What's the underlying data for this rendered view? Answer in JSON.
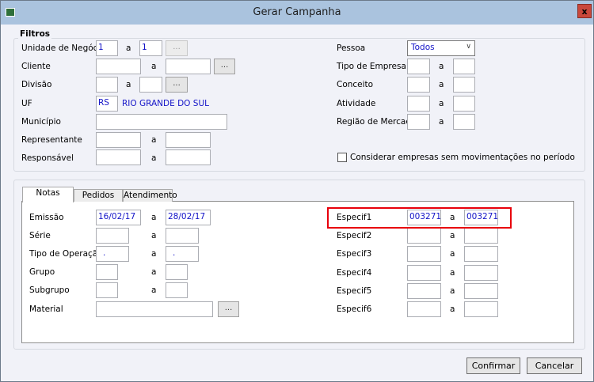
{
  "window": {
    "title": "Gerar Campanha",
    "close_label": "x"
  },
  "filtros": {
    "title": "Filtros",
    "unidade": {
      "label": "Unidade de Negócio",
      "from": "1",
      "sep": "a",
      "to": "1",
      "btn": "..."
    },
    "cliente": {
      "label": "Cliente",
      "from": "",
      "sep": "a",
      "to": "",
      "btn": "..."
    },
    "divisao": {
      "label": "Divisão",
      "from": "",
      "sep": "a",
      "to": "",
      "btn": "..."
    },
    "uf": {
      "label": "UF",
      "code": "RS",
      "name": "RIO GRANDE DO SUL"
    },
    "municipio": {
      "label": "Município",
      "value": ""
    },
    "representante": {
      "label": "Representante",
      "from": "",
      "sep": "a",
      "to": ""
    },
    "responsavel": {
      "label": "Responsável",
      "from": "",
      "sep": "a",
      "to": ""
    },
    "pessoa": {
      "label": "Pessoa",
      "value": "Todos"
    },
    "tipo_empresa": {
      "label": "Tipo de Empresa",
      "sep": "a"
    },
    "conceito": {
      "label": "Conceito",
      "sep": "a"
    },
    "atividade": {
      "label": "Atividade",
      "sep": "a"
    },
    "regiao": {
      "label": "Região de Mercado",
      "sep": "a"
    },
    "considerar": {
      "label": "Considerar empresas sem movimentações no período",
      "checked": false
    }
  },
  "tabs": [
    {
      "label": "Notas",
      "active": true
    },
    {
      "label": "Pedidos"
    },
    {
      "label": "Atendimento"
    }
  ],
  "notas": {
    "emissao": {
      "label": "Emissão",
      "from": "16/02/17",
      "sep": "a",
      "to": "28/02/17"
    },
    "serie": {
      "label": "Série",
      "from": "",
      "sep": "a",
      "to": ""
    },
    "tipo_operacao": {
      "label": "Tipo de Operação",
      "from": ".",
      "sep": "a",
      "to": "."
    },
    "grupo": {
      "label": "Grupo",
      "from": "",
      "sep": "a",
      "to": ""
    },
    "subgrupo": {
      "label": "Subgrupo",
      "from": "",
      "sep": "a",
      "to": ""
    },
    "material": {
      "label": "Material",
      "value": "",
      "btn": "..."
    },
    "especif": [
      {
        "label": "Especif1",
        "from": "003271",
        "sep": "a",
        "to": "003271"
      },
      {
        "label": "Especif2",
        "from": "",
        "sep": "a",
        "to": ""
      },
      {
        "label": "Especif3",
        "from": "",
        "sep": "a",
        "to": ""
      },
      {
        "label": "Especif4",
        "from": "",
        "sep": "a",
        "to": ""
      },
      {
        "label": "Especif5",
        "from": "",
        "sep": "a",
        "to": ""
      },
      {
        "label": "Especif6",
        "from": "",
        "sep": "a",
        "to": ""
      }
    ]
  },
  "actions": {
    "confirm": "Confirmar",
    "cancel": "Cancelar"
  },
  "colors": {
    "highlight": "#e8000b",
    "titlebar": "#aac3de",
    "value_text": "#1414c8"
  }
}
